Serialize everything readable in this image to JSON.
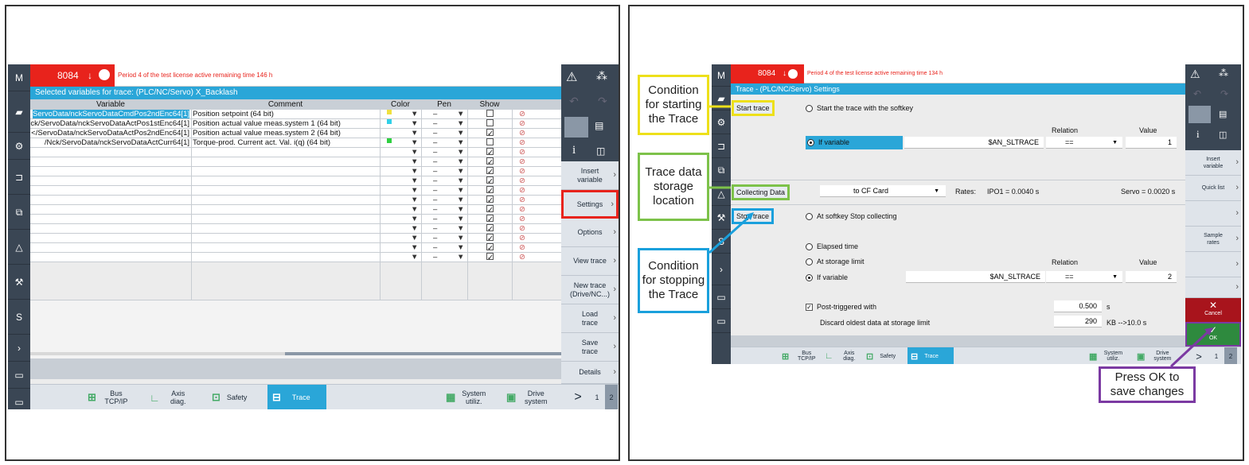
{
  "left": {
    "alarm": {
      "number": "8084",
      "arrow": "↓",
      "message": "Period 4 of the test license active remaining time 146 h"
    },
    "header": "Selected variables for trace:  (PLC/NC/Servo) X_Backlash",
    "columns": {
      "variable": "Variable",
      "comment": "Comment",
      "color": "Color",
      "pen": "Pen",
      "show": "Show"
    },
    "rows": [
      {
        "variable": "ServoData/nckServoDataCmdPos2ndEnc64[1]",
        "comment": "Position setpoint (64 bit)",
        "color": "#f0e040",
        "pen": "–",
        "show": false,
        "selected": true
      },
      {
        "variable": "ck/ServoData/nckServoDataActPos1stEnc64[1]",
        "comment": "Position actual value meas.system 1 (64 bit)",
        "color": "#30d0e8",
        "pen": "–",
        "show": false,
        "selected": false
      },
      {
        "variable": "</ServoData/nckServoDataActPos2ndEnc64[1]",
        "comment": "Position actual value meas.system 2 (64 bit)",
        "color": "#ffffff",
        "pen": "–",
        "show": true,
        "selected": false
      },
      {
        "variable": "/Nck/ServoData/nckServoDataActCurr64[1]",
        "comment": "Torque-prod. Current act. Val. i(q) (64 bit)",
        "color": "#2fd040",
        "pen": "–",
        "show": false,
        "selected": false
      },
      {
        "variable": "",
        "comment": "",
        "color": "#ffffff",
        "pen": "–",
        "show": true,
        "selected": false
      },
      {
        "variable": "",
        "comment": "",
        "color": "#ffffff",
        "pen": "–",
        "show": true,
        "selected": false
      },
      {
        "variable": "",
        "comment": "",
        "color": "#ffffff",
        "pen": "–",
        "show": true,
        "selected": false
      },
      {
        "variable": "",
        "comment": "",
        "color": "#ffffff",
        "pen": "–",
        "show": true,
        "selected": false
      },
      {
        "variable": "",
        "comment": "",
        "color": "#ffffff",
        "pen": "–",
        "show": true,
        "selected": false
      },
      {
        "variable": "",
        "comment": "",
        "color": "#ffffff",
        "pen": "–",
        "show": true,
        "selected": false
      },
      {
        "variable": "",
        "comment": "",
        "color": "#ffffff",
        "pen": "–",
        "show": true,
        "selected": false
      },
      {
        "variable": "",
        "comment": "",
        "color": "#ffffff",
        "pen": "–",
        "show": true,
        "selected": false
      },
      {
        "variable": "",
        "comment": "",
        "color": "#ffffff",
        "pen": "–",
        "show": true,
        "selected": false
      },
      {
        "variable": "",
        "comment": "",
        "color": "#ffffff",
        "pen": "–",
        "show": true,
        "selected": false
      },
      {
        "variable": "",
        "comment": "",
        "color": "#ffffff",
        "pen": "–",
        "show": true,
        "selected": false
      },
      {
        "variable": "",
        "comment": "",
        "color": "#ffffff",
        "pen": "–",
        "show": true,
        "selected": false
      }
    ],
    "softkeys": {
      "insert": "Insert variable",
      "settings": "Settings",
      "options": "Options",
      "view": "View trace",
      "new": "New trace (Drive/NC...)",
      "load": "Load trace",
      "save": "Save trace",
      "details": "Details"
    },
    "bottom": {
      "bus": "Bus TCP/IP",
      "axis": "Axis diag.",
      "safety": "Safety",
      "trace": "Trace",
      "sysutil": "System utiliz.",
      "drive": "Drive system",
      "next": ">",
      "p1": "1",
      "p2": "2"
    }
  },
  "right": {
    "alarm": {
      "number": "8084",
      "arrow": "↓",
      "message": "Period 4 of the test license active remaining time 134 h"
    },
    "header": "Trace - (PLC/NC/Servo) Settings",
    "start_trace": "Start trace",
    "start_softkey": "Start the trace with the softkey",
    "relation": "Relation",
    "value": "Value",
    "if_variable": "If variable",
    "var_name": "$AN_SLTRACE",
    "start_relation": "==",
    "start_value": "1",
    "collecting": "Collecting Data",
    "storage": "to CF Card",
    "rates": "Rates:",
    "ipo": "IPO1 = 0.0040 s",
    "servo": "Servo = 0.0020 s",
    "stop_trace": "Stop trace",
    "stop_softkey": "At softkey Stop collecting",
    "elapsed": "Elapsed time",
    "storage_limit": "At storage limit",
    "stop_relation": "==",
    "stop_value": "2",
    "post_triggered": "Post-triggered with",
    "post_value": "0.500",
    "post_unit": "s",
    "discard": "Discard oldest data at storage limit",
    "discard_value": "290",
    "discard_unit": "KB -->10.0 s",
    "softkeys": {
      "insert": "Insert variable",
      "quick": "Quick list",
      "sample": "Sample rates",
      "cancel": "Cancel",
      "ok": "OK"
    },
    "bottom": {
      "bus": "Bus TCP/IP",
      "axis": "Axis diag.",
      "safety": "Safety",
      "trace": "Trace",
      "sysutil": "System utiliz.",
      "drive": "Drive system",
      "next": ">",
      "p1": "1",
      "p2": "2"
    }
  },
  "callouts": {
    "start": "Condition for starting the Trace",
    "storage": "Trace data storage location",
    "stop": "Condition for stopping the Trace",
    "ok": "Press OK to save changes"
  },
  "colors": {
    "yellow": "#ede01a",
    "green": "#7dc24a",
    "blue": "#1aa0dc",
    "purple": "#7b3aa2",
    "red": "#e8231c",
    "accent": "#2aa6d8"
  }
}
